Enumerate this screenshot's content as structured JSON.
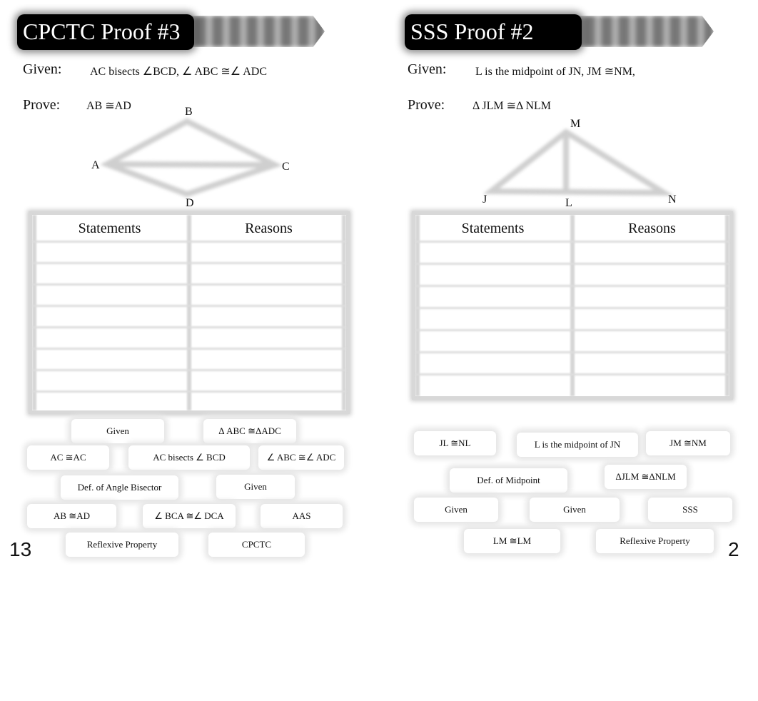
{
  "left": {
    "title": "CPCTC Proof #3",
    "given_label": "Given:",
    "given_text": "AC  bisects   ∠BCD,  ∠ ABC ≅∠ ADC",
    "prove_label": "Prove:",
    "prove_text": "AB ≅AD",
    "points": {
      "A": "A",
      "B": "B",
      "C": "C",
      "D": "D"
    },
    "table": {
      "headers": [
        "Statements",
        "Reasons"
      ]
    },
    "tiles": [
      "Given",
      "Δ ABC  ≅ΔADC",
      "AC  ≅AC",
      "AC  bisects   ∠ BCD",
      "∠ ABC ≅∠ ADC",
      "Def. of Angle Bisector",
      "Given",
      "AB ≅AD",
      "∠ BCA  ≅∠ DCA",
      "AAS",
      "Reflexive Property",
      "CPCTC"
    ],
    "page_number": "13"
  },
  "right": {
    "title": "SSS Proof #2",
    "given_label": "Given:",
    "given_text": "L is the midpoint of      JN,  JM   ≅NM,",
    "prove_label": "Prove:",
    "prove_text": "Δ JLM ≅Δ  NLM",
    "points": {
      "M": "M",
      "J": "J",
      "L": "L",
      "N": "N"
    },
    "table": {
      "headers": [
        "Statements",
        "Reasons"
      ]
    },
    "tiles": [
      "JL ≅NL",
      "L is the midpoint of      JN",
      "JM  ≅NM",
      "Def. of Midpoint",
      "ΔJLM ≅ΔNLM",
      "Given",
      "Given",
      "SSS",
      "LM ≅LM",
      "Reflexive Property"
    ],
    "page_number": "2"
  }
}
